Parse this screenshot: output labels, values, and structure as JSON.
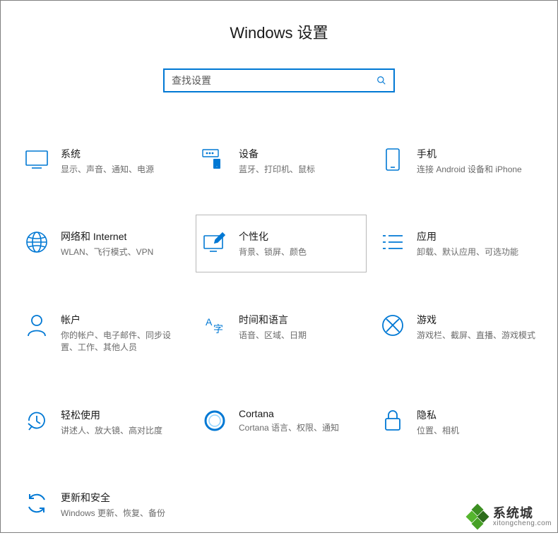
{
  "header": {
    "title": "Windows 设置"
  },
  "search": {
    "placeholder": "查找设置"
  },
  "tiles": {
    "system": {
      "title": "系统",
      "desc": "显示、声音、通知、电源"
    },
    "devices": {
      "title": "设备",
      "desc": "蓝牙、打印机、鼠标"
    },
    "phone": {
      "title": "手机",
      "desc": "连接 Android 设备和 iPhone"
    },
    "network": {
      "title": "网络和 Internet",
      "desc": "WLAN、飞行模式、VPN"
    },
    "personalization": {
      "title": "个性化",
      "desc": "背景、锁屏、颜色"
    },
    "apps": {
      "title": "应用",
      "desc": "卸载、默认应用、可选功能"
    },
    "accounts": {
      "title": "帐户",
      "desc": "你的帐户、电子邮件、同步设置、工作、其他人员"
    },
    "time": {
      "title": "时间和语言",
      "desc": "语音、区域、日期"
    },
    "gaming": {
      "title": "游戏",
      "desc": "游戏栏、截屏、直播、游戏模式"
    },
    "ease": {
      "title": "轻松使用",
      "desc": "讲述人、放大镜、高对比度"
    },
    "cortana": {
      "title": "Cortana",
      "desc": "Cortana 语言、权限、通知"
    },
    "privacy": {
      "title": "隐私",
      "desc": "位置、相机"
    },
    "update": {
      "title": "更新和安全",
      "desc": "Windows 更新、恢复、备份"
    }
  },
  "watermark": {
    "brand": "系统城",
    "url": "xitongcheng.com"
  },
  "colors": {
    "accent": "#0078d4",
    "text_primary": "#1a1a1a",
    "text_secondary": "#6b6b6b",
    "highlight_border": "#b8b8b8"
  }
}
